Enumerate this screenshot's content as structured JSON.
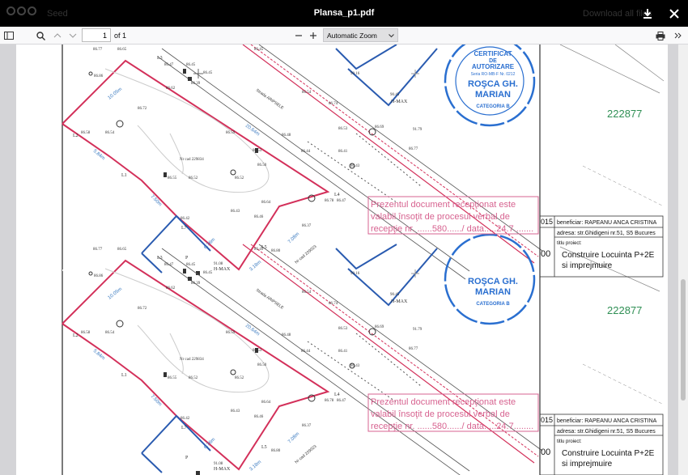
{
  "app": {
    "brand": "Seed",
    "download_label": "Download all files"
  },
  "document": {
    "title": "Plansa_p1.pdf"
  },
  "toolbar": {
    "page_number": "1",
    "page_count_label": "of 1",
    "zoom_label": "Automatic Zoom"
  },
  "plan": {
    "parcel_id": "Nr cad 229834",
    "street_label": "Strada ARIPSELE",
    "elevation_labels": [
      "86.77",
      "86.65",
      "86.47",
      "86.45",
      "86.86",
      "86.39",
      "86.62",
      "86.45",
      "86.74",
      "86.72",
      "86.59",
      "86.58",
      "86.53",
      "86.50",
      "86.44",
      "86.52",
      "86.55",
      "86.64",
      "86.42",
      "86.46",
      "86.37",
      "86.47",
      "86.43",
      "86.80",
      "91.08",
      "86.43",
      "86.78",
      "86.67",
      "90.16",
      "90.45",
      "86.69",
      "91.79"
    ],
    "dimension_labels": [
      "10.05m",
      "20.64m",
      "5.84m",
      "7.50m",
      "6.76m",
      "3.18m",
      "7.08m"
    ],
    "point_labels": [
      "L3",
      "L2",
      "L1",
      "L4",
      "L5",
      "L7",
      "P",
      "H-MAX"
    ],
    "stamp": {
      "lines": [
        "CERTIFICAT",
        "DE",
        "AUTORIZARE",
        "Seria RO-MB-F Nr. 0212"
      ],
      "name_lines": [
        "ROŞCA GH.",
        "MARIAN"
      ],
      "category": "CATEGORIA B"
    },
    "reception_note": {
      "line1": "Prezentul document recepţionat este",
      "line2": "valabil însoţit de procesul verbal de",
      "line3": "recepţie nr. ......580....../ data.....24.7........"
    },
    "number_label": "222877",
    "title_block": {
      "beneficiary": "beneficiar:  RAPEANU ANCA CRISTINA",
      "address": "adresa: str.Ghidigeni nr.51, S5 Bucures",
      "project_label": "titlu proiect:",
      "project_line1": "Construire Locuinta P+2E",
      "project_line2": "si imprejmuire",
      "year_fragment": "015",
      "scale_fragment": "00"
    }
  }
}
